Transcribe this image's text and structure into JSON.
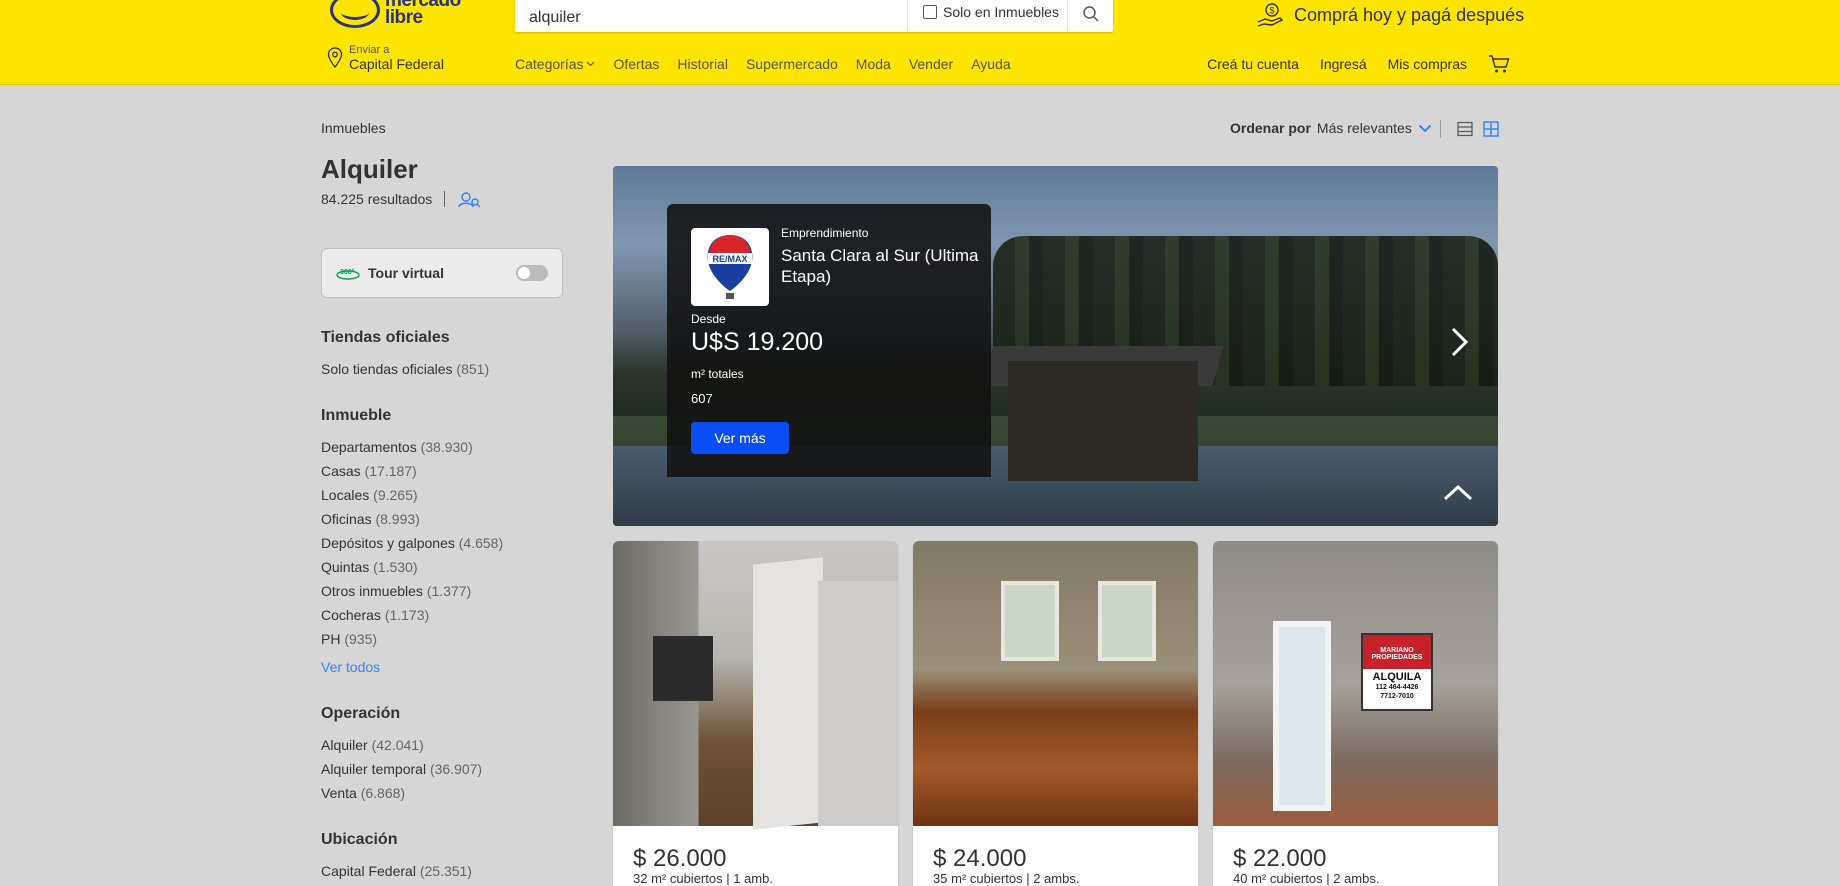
{
  "header": {
    "logo_text_line1": "mercado",
    "logo_text_line2": "libre",
    "search_value": "alquiler",
    "search_checkbox_label": "Solo en Inmuebles",
    "promo_text": "Comprá hoy y pagá después",
    "location_label": "Enviar a",
    "location_value": "Capital Federal",
    "nav": [
      "Categorías",
      "Ofertas",
      "Historial",
      "Supermercado",
      "Moda",
      "Vender",
      "Ayuda"
    ],
    "account": [
      "Creá tu cuenta",
      "Ingresá",
      "Mis compras"
    ]
  },
  "breadcrumb": "Inmuebles",
  "page_title": "Alquiler",
  "results_count": "84.225 resultados",
  "sort": {
    "label": "Ordenar por",
    "value": "Más relevantes"
  },
  "tour_virtual": {
    "label": "Tour virtual",
    "badge": "360°",
    "enabled": false
  },
  "filters": {
    "tiendas": {
      "title": "Tiendas oficiales",
      "items": [
        {
          "label": "Solo tiendas oficiales",
          "count": "(851)"
        }
      ]
    },
    "inmueble": {
      "title": "Inmueble",
      "items": [
        {
          "label": "Departamentos",
          "count": "(38.930)"
        },
        {
          "label": "Casas",
          "count": "(17.187)"
        },
        {
          "label": "Locales",
          "count": "(9.265)"
        },
        {
          "label": "Oficinas",
          "count": "(8.993)"
        },
        {
          "label": "Depósitos y galpones",
          "count": "(4.658)"
        },
        {
          "label": "Quintas",
          "count": "(1.530)"
        },
        {
          "label": "Otros inmuebles",
          "count": "(1.377)"
        },
        {
          "label": "Cocheras",
          "count": "(1.173)"
        },
        {
          "label": "PH",
          "count": "(935)"
        }
      ],
      "more": "Ver todos"
    },
    "operacion": {
      "title": "Operación",
      "items": [
        {
          "label": "Alquiler",
          "count": "(42.041)"
        },
        {
          "label": "Alquiler temporal",
          "count": "(36.907)"
        },
        {
          "label": "Venta",
          "count": "(6.868)"
        }
      ]
    },
    "ubicacion": {
      "title": "Ubicación",
      "items": [
        {
          "label": "Capital Federal",
          "count": "(25.351)"
        }
      ]
    }
  },
  "hero": {
    "tag": "Emprendimiento",
    "name": "Santa Clara al Sur (Ultima Etapa)",
    "desde": "Desde",
    "price": "U$S 19.200",
    "m2_label": "m² totales",
    "m2_value": "607",
    "button": "Ver más",
    "logo_text": "RE/MAX"
  },
  "cards": [
    {
      "price": "$ 26.000",
      "desc": "32 m² cubiertos | 1 amb."
    },
    {
      "price": "$ 24.000",
      "desc": "35 m² cubiertos | 2 ambs."
    },
    {
      "price": "$ 22.000",
      "desc": "40 m² cubiertos | 2 ambs.",
      "sign": {
        "brand": "MARIANO PROPIEDADES",
        "word": "ALQUILA",
        "phone1": "112 464-4426",
        "phone2": "7712-7010"
      }
    }
  ],
  "colors": {
    "header_bg": "#fde500",
    "accent_blue": "#3483fa",
    "button_blue": "#0a4df5"
  }
}
